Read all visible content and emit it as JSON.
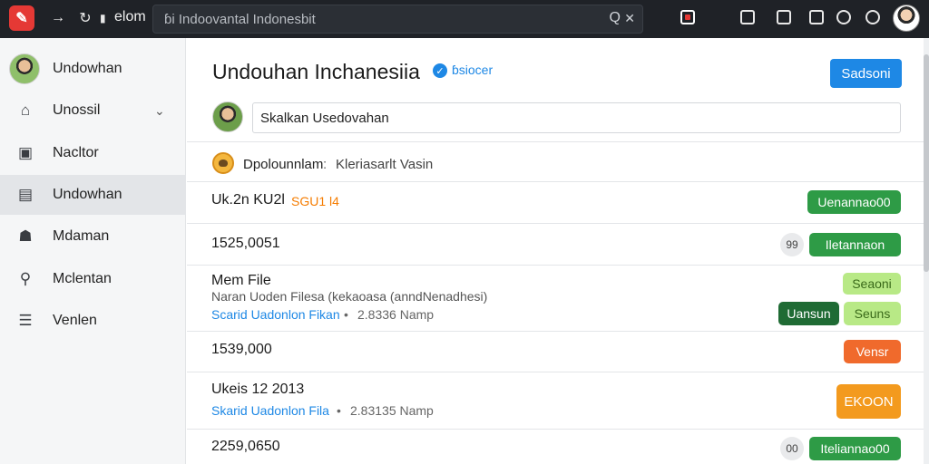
{
  "browser": {
    "site_name": "elom",
    "address_text": "ɓi Indoovantal Indonesbit",
    "search_icon": "search-icon",
    "close_icon": "close-icon"
  },
  "sidebar": {
    "items": [
      {
        "label": "Undowhan",
        "icon": "user-avatar"
      },
      {
        "label": "Unossil",
        "icon": "home-icon"
      },
      {
        "label": "Nacltor",
        "icon": "clipboard-icon"
      },
      {
        "label": "Undowhan",
        "icon": "chat-icon"
      },
      {
        "label": "Mdaman",
        "icon": "users-icon"
      },
      {
        "label": "Mclentan",
        "icon": "link-icon"
      },
      {
        "label": "Venlen",
        "icon": "list-icon"
      }
    ]
  },
  "main": {
    "title": "Undouhan Inchanesiia",
    "verified_label": "ɓsiocer",
    "primary_button": "Sadsoni",
    "compose_value": "Skalkan Usedovahan",
    "filter": {
      "label": "Dpolounnlam",
      "separator": ":",
      "value": "Kleriasarlt Vasin"
    },
    "rows": [
      {
        "title": "Uk.2n KU2l",
        "badge": "SGU1 l4",
        "action": "Uenannao00"
      },
      {
        "title": "1525,0051",
        "count": "99",
        "action": "Iletannaon"
      },
      {
        "title": "Mem File",
        "subtitle": "Naran Uoden Filesa (kekaoasa (anndNenadhesi)",
        "link": "Scarid Uadonlon Fikan",
        "dot": "•",
        "size": "2.8336 Namp",
        "action_top": "Seaoni",
        "action_dark": "Uansun",
        "action_lime": "Seuns"
      },
      {
        "title": "1539,000",
        "action": "Vensr"
      },
      {
        "title": "Ukeis 12 2013",
        "link": "Skarid Uadonlon Fila",
        "dot": "•",
        "size": "2.83135 Namp",
        "action": "EKOON"
      },
      {
        "title": "2259,0650",
        "count": "00",
        "action": "Iteliannao00"
      }
    ]
  }
}
